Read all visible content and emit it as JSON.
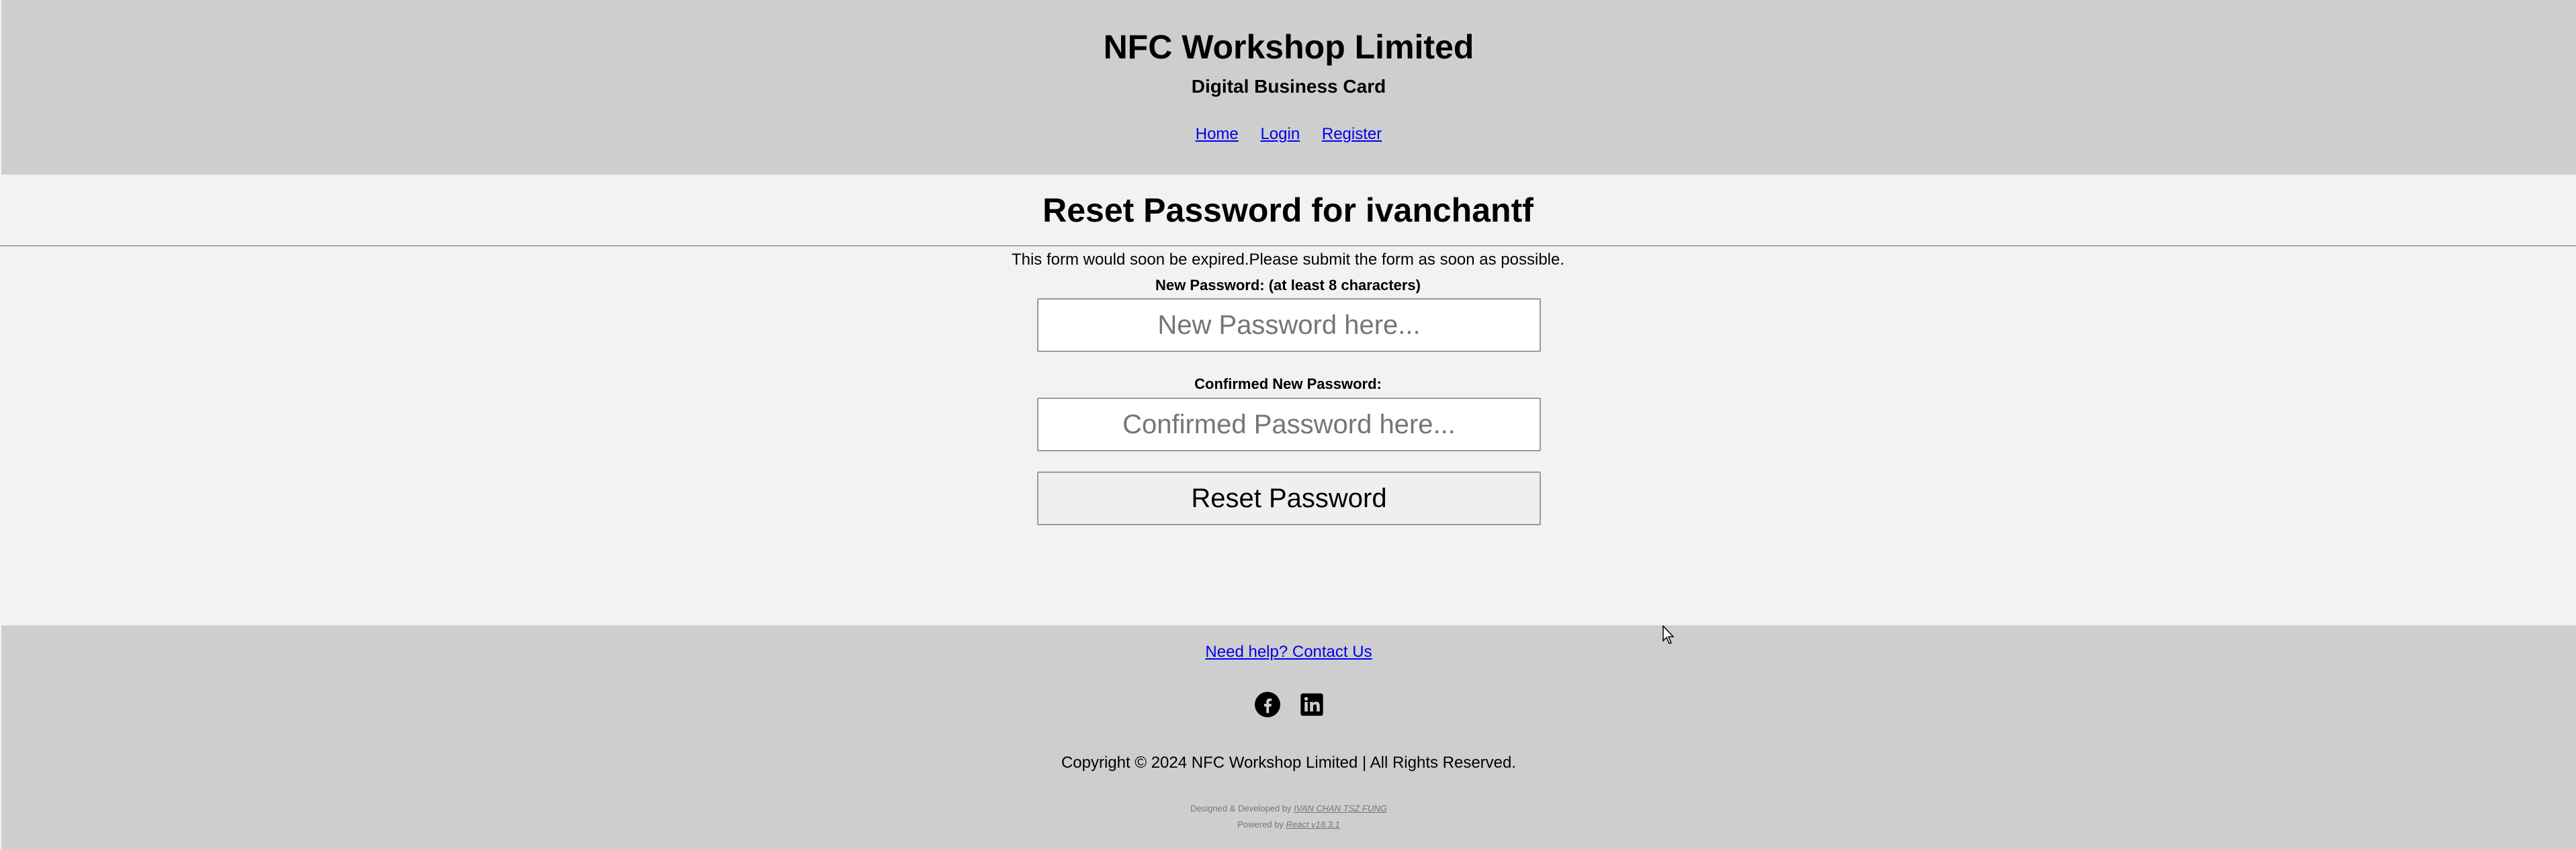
{
  "header": {
    "company": "NFC Workshop Limited",
    "tagline": "Digital Business Card",
    "nav": {
      "home": "Home",
      "login": "Login",
      "register": "Register"
    }
  },
  "title": "Reset Password for ivanchantf",
  "form": {
    "notice": "This form would soon be expired.Please submit the form as soon as possible.",
    "new_password_label": "New Password: (at least 8 characters)",
    "new_password_placeholder": "New Password here...",
    "confirm_label": "Confirmed New Password:",
    "confirm_placeholder": "Confirmed Password here...",
    "submit_label": "Reset Password"
  },
  "footer": {
    "help_link": "Need help? Contact Us",
    "social_icons": [
      "facebook-icon",
      "linkedin-icon"
    ],
    "copyright": "Copyright © 2024 NFC Workshop Limited | All Rights Reserved.",
    "designed_prefix": "Designed & Developed by",
    "designer": "IVAN CHAN TSZ FUNG",
    "powered_prefix": "Powered by",
    "powered_link": "React v18.3.1"
  },
  "colors": {
    "header_bg": "#cecece",
    "page_bg": "#f2f2f2",
    "link": "#0000ee"
  }
}
